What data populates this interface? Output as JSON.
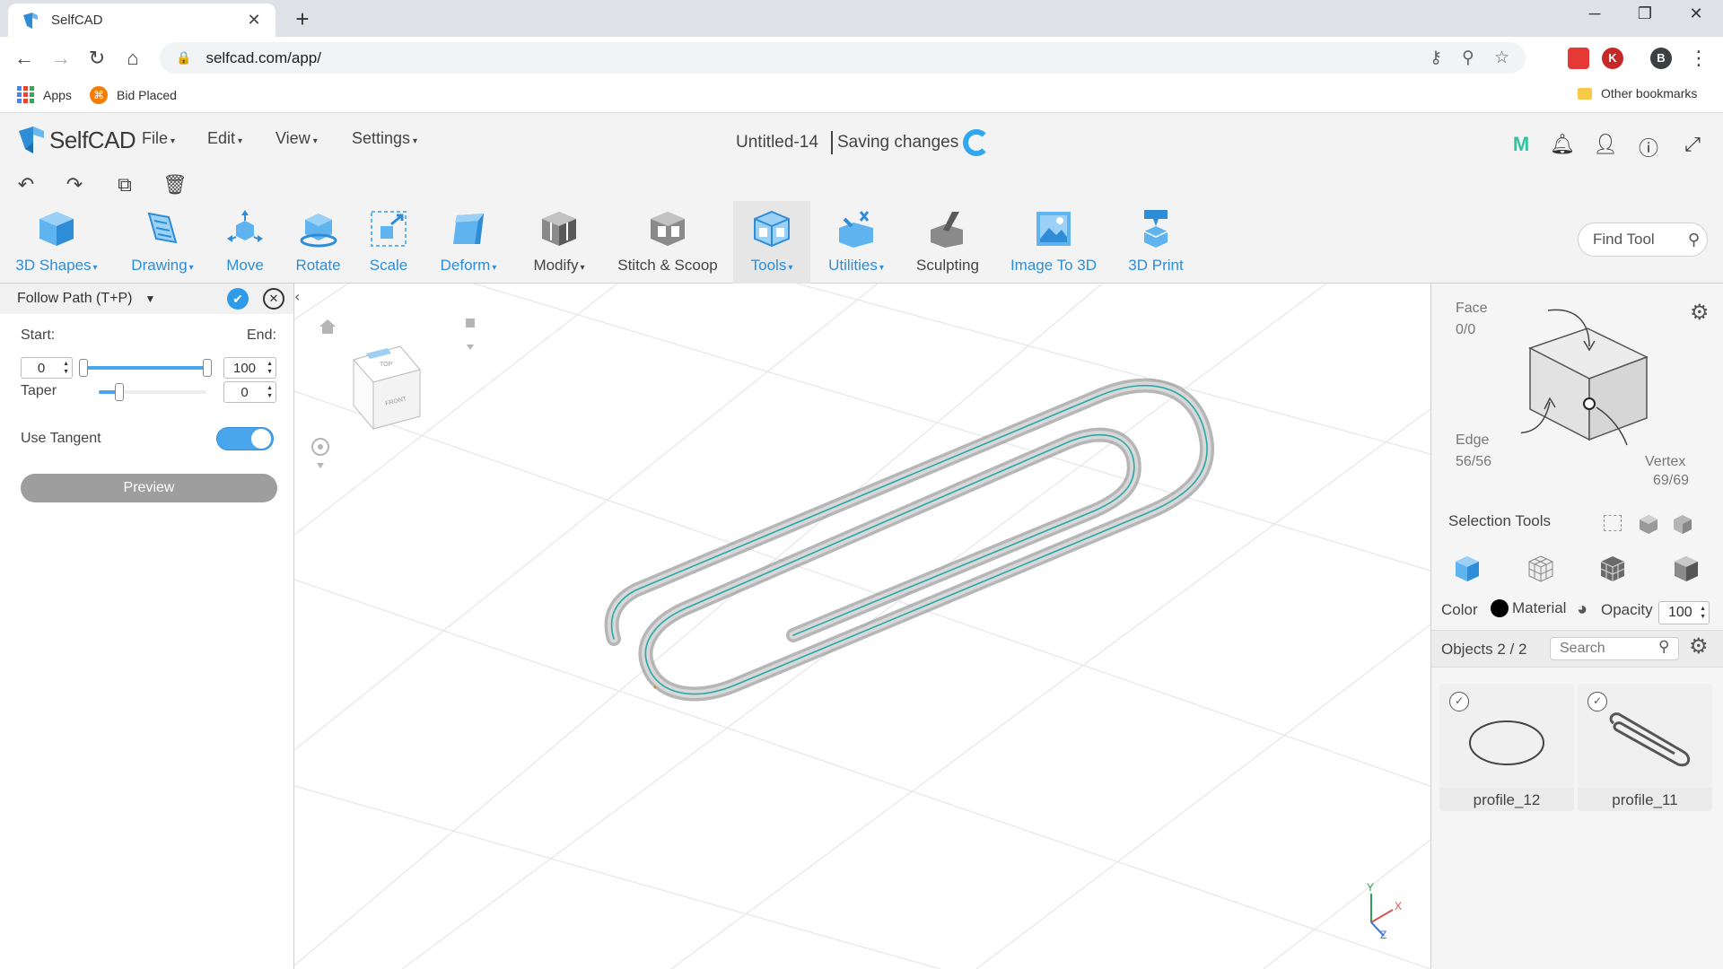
{
  "browser": {
    "tab_title": "SelfCAD",
    "tab_close": "✕",
    "new_tab": "+",
    "url": "selfcad.com/app/",
    "ext_k": "K",
    "profile": "B",
    "bookmarks": [
      {
        "label": "Apps"
      },
      {
        "label": "Bid Placed"
      }
    ],
    "other_bookmarks": "Other bookmarks"
  },
  "app": {
    "brand": "SelfCAD",
    "menus": [
      "File",
      "Edit",
      "View",
      "Settings"
    ],
    "doc_title": "Untitled-14",
    "saving_status": "Saving changes",
    "brand_color": "#2f8cd6",
    "m_icon": "M"
  },
  "toolbar": {
    "tools": [
      {
        "label": "3D Shapes",
        "dropdown": "▾",
        "icon": "cube-icon"
      },
      {
        "label": "Drawing",
        "dropdown": "▾",
        "icon": "drawing-icon"
      },
      {
        "label": "Move",
        "icon": "move-icon"
      },
      {
        "label": "Rotate",
        "icon": "rotate-icon"
      },
      {
        "label": "Scale",
        "icon": "scale-icon"
      },
      {
        "label": "Deform",
        "dropdown": "▾",
        "icon": "deform-icon"
      },
      {
        "label": "Modify",
        "dropdown": "▾",
        "icon": "modify-icon"
      },
      {
        "label": "Stitch & Scoop",
        "icon": "stitch-scoop-icon"
      },
      {
        "label": "Tools",
        "dropdown": "▾",
        "icon": "tools-icon"
      },
      {
        "label": "Utilities",
        "dropdown": "▾",
        "icon": "utilities-icon"
      },
      {
        "label": "Sculpting",
        "icon": "sculpting-icon"
      },
      {
        "label": "Image To 3D",
        "icon": "image-to-3d-icon"
      },
      {
        "label": "3D Print",
        "icon": "3d-print-icon"
      }
    ],
    "find_tool_placeholder": "Find Tool"
  },
  "follow_path": {
    "title": "Follow Path (T+P)",
    "start_label": "Start:",
    "end_label": "End:",
    "start_value": "0",
    "end_value": "100",
    "taper_label": "Taper",
    "taper_value": "0",
    "use_tangent_label": "Use Tangent",
    "use_tangent_on": true,
    "preview_label": "Preview"
  },
  "viewcube": {
    "top": "TOP",
    "front": "FRONT"
  },
  "axes": {
    "x": "X",
    "y": "Y",
    "z": "Z"
  },
  "selection": {
    "face_label": "Face",
    "face_value": "0/0",
    "edge_label": "Edge",
    "edge_value": "56/56",
    "vertex_label": "Vertex",
    "vertex_value": "69/69",
    "tools_label": "Selection Tools"
  },
  "appearance": {
    "color_label": "Color",
    "color_value": "#000000",
    "material_label": "Material",
    "opacity_label": "Opacity",
    "opacity_value": "100"
  },
  "objects": {
    "header": "Objects 2 / 2",
    "search_placeholder": "Search",
    "items": [
      {
        "name": "profile_12"
      },
      {
        "name": "profile_11"
      }
    ]
  }
}
